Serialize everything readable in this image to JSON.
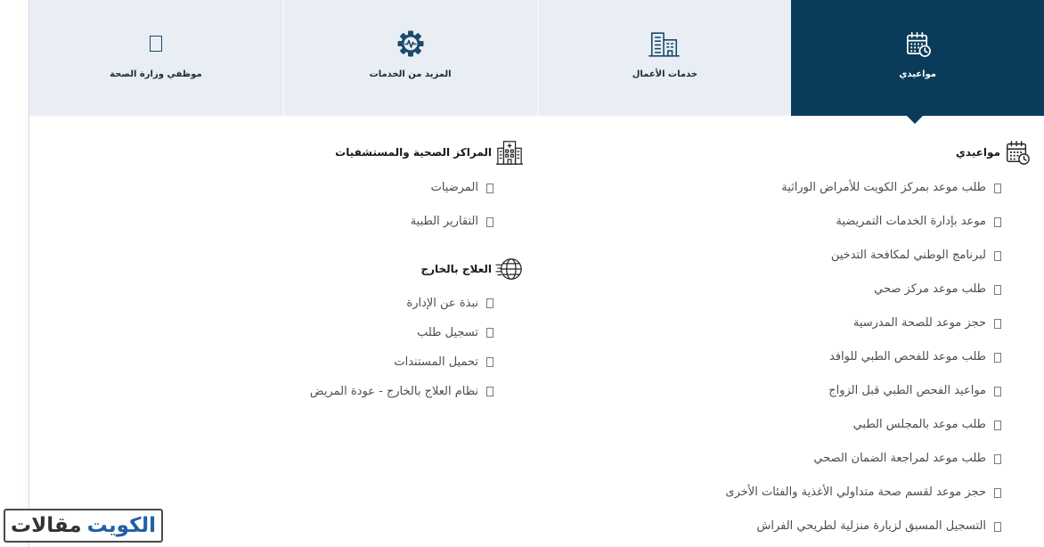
{
  "tabs": [
    {
      "label": "مواعيدي",
      "icon": "calendar-clock-icon",
      "active": true
    },
    {
      "label": "خدمات الأعمال",
      "icon": "office-building-icon",
      "active": false
    },
    {
      "label": "المزيد من الخدمات",
      "icon": "gear-pulse-icon",
      "active": false
    },
    {
      "label": "موظفي وزارة الصحة",
      "icon": "placeholder-icon",
      "active": false
    }
  ],
  "appointments": {
    "heading": "مواعيدي",
    "icon": "calendar-clock-icon",
    "items": [
      "طلب موعد بمركز الكويت للأمراض الوراثية",
      "موعد بإدارة الخدمات التمريضية",
      "لبرنامج الوطني لمكافحة التدخين",
      "طلب موعد مركز صحي",
      "حجز موعد للصحة المدرسية",
      "طلب موعد للفحص الطبي للوافد",
      "مواعيد الفحص الطبي قبل الزواج",
      "طلب موعد بالمجلس الطبي",
      "طلب موعد لمراجعة الضمان الصحي",
      "حجز موعد لقسم صحة متداولي الأغذية والفئات الأخرى",
      "التسجيل المسبق لزيارة منزلية لطريحي الفراش"
    ]
  },
  "health_centers": {
    "heading": "المراكز الصحية والمستشفيات",
    "icon": "hospital-building-icon",
    "items": [
      "المرضيات",
      "التقارير الطبية"
    ]
  },
  "treatment_abroad": {
    "heading": "العلاج بالخارج",
    "icon": "globe-network-icon",
    "items": [
      "نبذة عن الإدارة",
      "تسجيل طلب",
      "تحميل المستندات",
      "نظام العلاج بالخارج - عودة المريض"
    ]
  },
  "watermark": {
    "word_dark": "مقالات",
    "word_blue": "الكويت"
  },
  "colors": {
    "active_tab": "#0b3b5a",
    "tab_bar": "#e8eef3",
    "tab_icon": "#1c4a6b",
    "item_text": "#4d4d4d",
    "heading_text": "#1a1a1a",
    "watermark_blue": "#1f5fa6",
    "watermark_dark": "#333333"
  }
}
